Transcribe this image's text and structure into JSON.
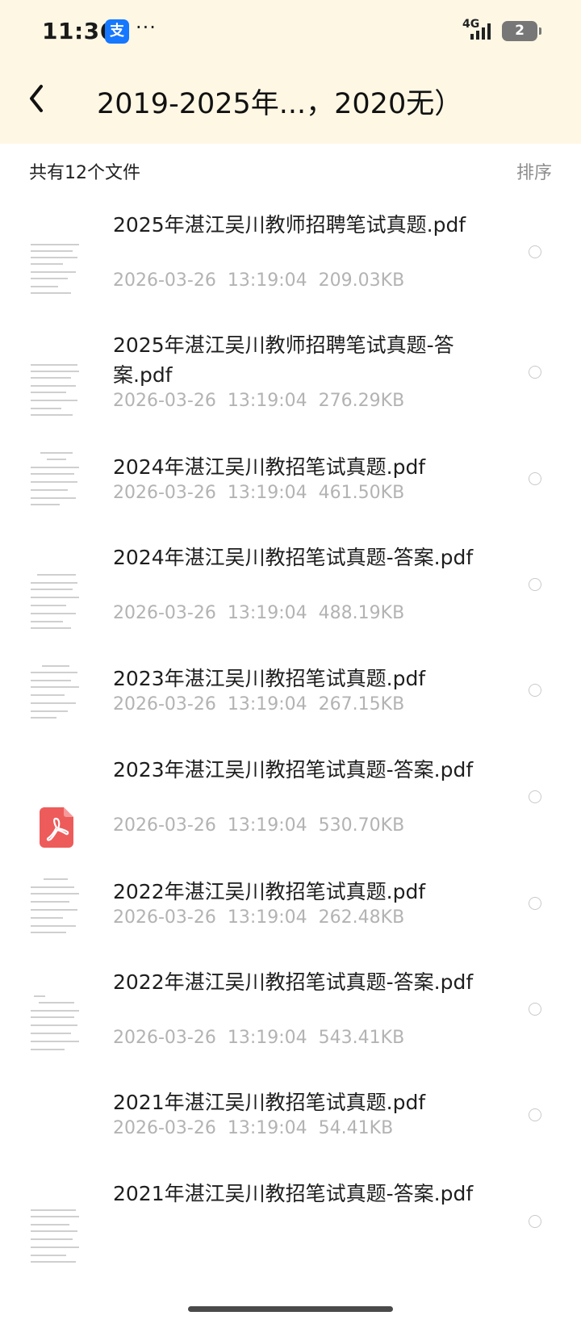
{
  "status": {
    "time": "11:36",
    "more": "···",
    "network": "4G",
    "battery": "2"
  },
  "header": {
    "title": "2019-2025年...，2020无）"
  },
  "summary": {
    "count": "共有12个文件",
    "sort_label": "排序"
  },
  "files": [
    {
      "name": "2025年湛江吴川教师招聘笔试真题.pdf",
      "date": "2026-03-26",
      "time": "13:19:04",
      "size": "209.03KB"
    },
    {
      "name": "2025年湛江吴川教师招聘笔试真题-答案.pdf",
      "date": "2026-03-26",
      "time": "13:19:04",
      "size": "276.29KB"
    },
    {
      "name": "2024年湛江吴川教招笔试真题.pdf",
      "date": "2026-03-26",
      "time": "13:19:04",
      "size": "461.50KB"
    },
    {
      "name": "2024年湛江吴川教招笔试真题-答案.pdf",
      "date": "2026-03-26",
      "time": "13:19:04",
      "size": "488.19KB"
    },
    {
      "name": "2023年湛江吴川教招笔试真题.pdf",
      "date": "2026-03-26",
      "time": "13:19:04",
      "size": "267.15KB"
    },
    {
      "name": "2023年湛江吴川教招笔试真题-答案.pdf",
      "date": "2026-03-26",
      "time": "13:19:04",
      "size": "530.70KB"
    },
    {
      "name": "2022年湛江吴川教招笔试真题.pdf",
      "date": "2026-03-26",
      "time": "13:19:04",
      "size": "262.48KB"
    },
    {
      "name": "2022年湛江吴川教招笔试真题-答案.pdf",
      "date": "2026-03-26",
      "time": "13:19:04",
      "size": "543.41KB"
    },
    {
      "name": "2021年湛江吴川教招笔试真题.pdf",
      "date": "2026-03-26",
      "time": "13:19:04",
      "size": "54.41KB"
    },
    {
      "name": "2021年湛江吴川教招笔试真题-答案.pdf"
    }
  ],
  "colors": {
    "header_bg": "#fdf7e4",
    "pdf_red": "#ee5b5b",
    "meta_gray": "#b3b3b3"
  }
}
